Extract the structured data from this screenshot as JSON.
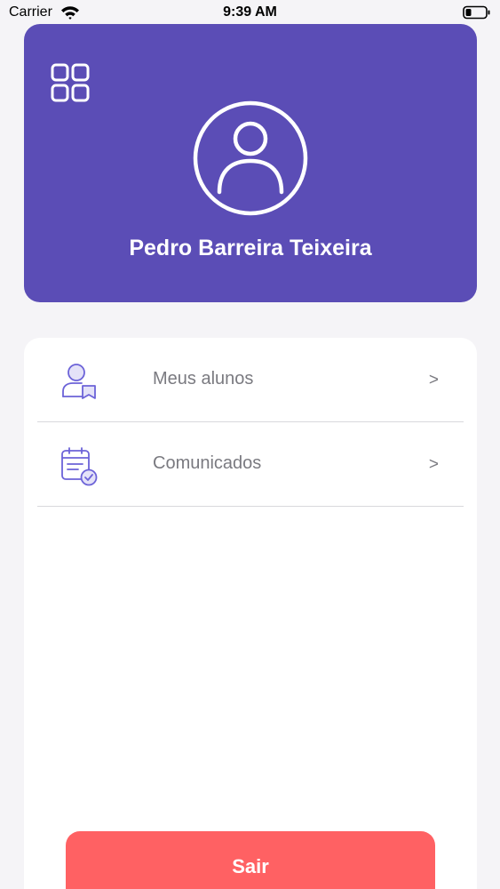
{
  "status_bar": {
    "carrier": "Carrier",
    "time": "9:39 AM"
  },
  "profile": {
    "name": "Pedro Barreira Teixeira",
    "menu_icon": "grid-icon",
    "avatar_icon": "user-circle-icon",
    "card_color": "#5b4db6"
  },
  "menu": {
    "items": [
      {
        "label": "Meus alunos",
        "icon": "student-badge-icon",
        "chevron": ">"
      },
      {
        "label": "Comunicados",
        "icon": "calendar-check-icon",
        "chevron": ">"
      }
    ]
  },
  "logout": {
    "label": "Sair",
    "color": "#ff6163"
  }
}
